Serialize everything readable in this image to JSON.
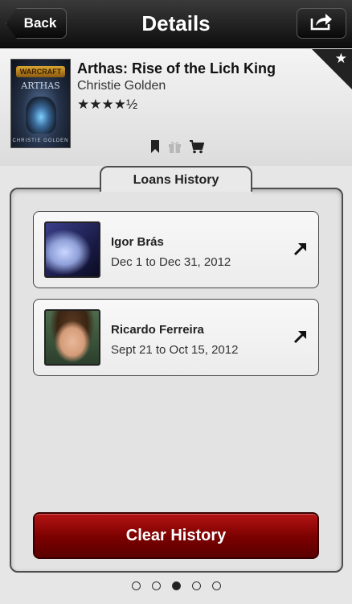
{
  "navbar": {
    "title": "Details",
    "back_label": "Back",
    "share_icon": "share-icon"
  },
  "book": {
    "title": "Arthas: Rise of the Lich King",
    "author": "Christie Golden",
    "rating_text": "★★★★½",
    "rating_value": 4.5,
    "cover": {
      "logo_text": "WARCRAFT",
      "title_text": "ARTHAS",
      "author_text": "CHRISTIE GOLDEN"
    },
    "favorite_icon": "star-icon",
    "action_icons": [
      "bookmark-icon",
      "gift-icon",
      "cart-icon"
    ]
  },
  "loans": {
    "heading": "Loans History",
    "items": [
      {
        "name": "Igor Brás",
        "dates": "Dec 1 to Dec 31, 2012"
      },
      {
        "name": "Ricardo Ferreira",
        "dates": "Sept 21 to Oct 15, 2012"
      }
    ]
  },
  "clear_button": {
    "label": "Clear History"
  },
  "pager": {
    "count": 5,
    "active": 3
  },
  "colors": {
    "navbar": "#1e1e1e",
    "clear_button": "#8b0000",
    "background": "#e6e6e6"
  }
}
